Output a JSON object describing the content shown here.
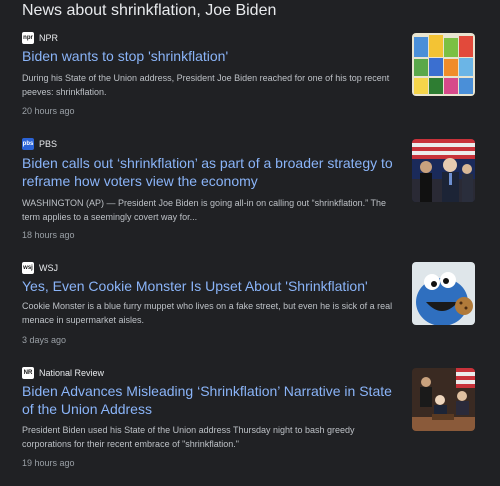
{
  "heading": "News about shrinkflation, Joe Biden",
  "articles": [
    {
      "source": "NPR",
      "logo_text": "npr",
      "title": "Biden wants to stop 'shrinkflation'",
      "snippet": "During his State of the Union address, President Joe Biden reached for one of his top recent peeves: shrinkflation.",
      "time": "20 hours ago",
      "thumb": "grocery-products-thumbnail"
    },
    {
      "source": "PBS",
      "logo_text": "pbs",
      "title": "Biden calls out ‘shrinkflation’ as part of a broader strategy to reframe how voters view the economy",
      "snippet": "WASHINGTON (AP) — President Joe Biden is going all-in on calling out “shrinkflation.” The term applies to a seemingly covert way for...",
      "time": "18 hours ago",
      "thumb": "biden-speech-thumbnail"
    },
    {
      "source": "WSJ",
      "logo_text": "wsj",
      "title": "Yes, Even Cookie Monster Is Upset About 'Shrinkflation'",
      "snippet": "Cookie Monster is a blue furry muppet who lives on a fake street, but even he is sick of a real menace in supermarket aisles.",
      "time": "3 days ago",
      "thumb": "cookie-monster-thumbnail"
    },
    {
      "source": "National Review",
      "logo_text": "NR",
      "title": "Biden Advances Misleading ‘Shrinkflation’ Narrative in State of the Union Address",
      "snippet": "President Biden used his State of the Union address Thursday night to bash greedy corporations for their recent embrace of \"shrinkflation.\"",
      "time": "19 hours ago",
      "thumb": "state-of-union-thumbnail"
    }
  ]
}
